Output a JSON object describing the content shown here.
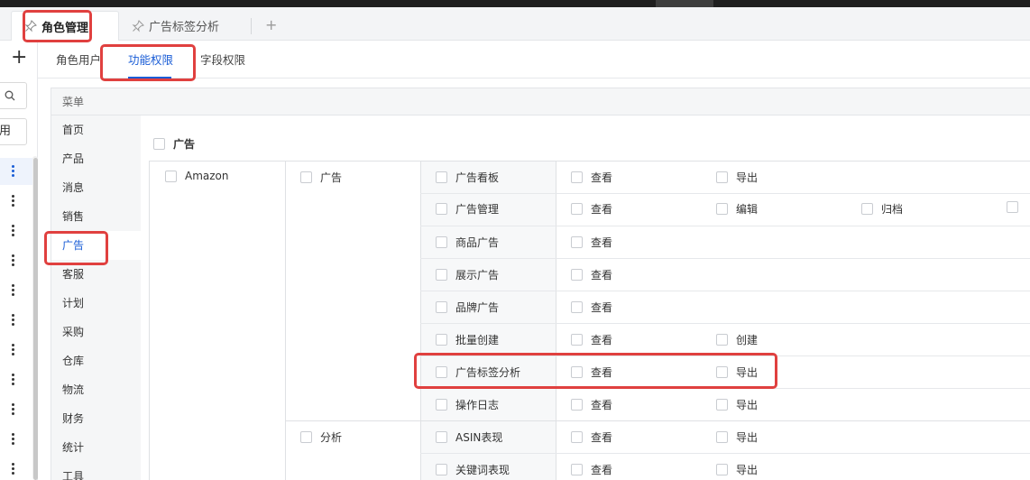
{
  "tabs": {
    "active": "角色管理",
    "inactive": "广告标签分析",
    "add": "+"
  },
  "left": {
    "plus": "+",
    "use_text": "用"
  },
  "subtabs": [
    "角色用户",
    "功能权限",
    "字段权限"
  ],
  "panel_header": "菜单",
  "menu": [
    "首页",
    "产品",
    "消息",
    "销售",
    "广告",
    "客服",
    "计划",
    "采购",
    "仓库",
    "物流",
    "财务",
    "统计",
    "工具"
  ],
  "active_menu": "广告",
  "section_title": "广告",
  "platform": "Amazon",
  "groups": [
    "广告",
    "分析"
  ],
  "rows": [
    {
      "name": "广告看板",
      "perms": [
        "查看",
        "导出"
      ]
    },
    {
      "name": "广告管理",
      "perms": [
        "查看",
        "编辑",
        "归档"
      ]
    },
    {
      "name": "商品广告",
      "perms": [
        "查看"
      ]
    },
    {
      "name": "展示广告",
      "perms": [
        "查看"
      ]
    },
    {
      "name": "品牌广告",
      "perms": [
        "查看"
      ]
    },
    {
      "name": "批量创建",
      "perms": [
        "查看",
        "创建"
      ]
    },
    {
      "name": "广告标签分析",
      "perms": [
        "查看",
        "导出"
      ]
    },
    {
      "name": "操作日志",
      "perms": [
        "查看",
        "导出"
      ]
    },
    {
      "name": "ASIN表现",
      "perms": [
        "查看",
        "导出"
      ]
    },
    {
      "name": "关键词表现",
      "perms": [
        "查看",
        "导出"
      ]
    }
  ],
  "colors": {
    "accent": "#1a5dd6",
    "highlight": "#e0403f"
  }
}
